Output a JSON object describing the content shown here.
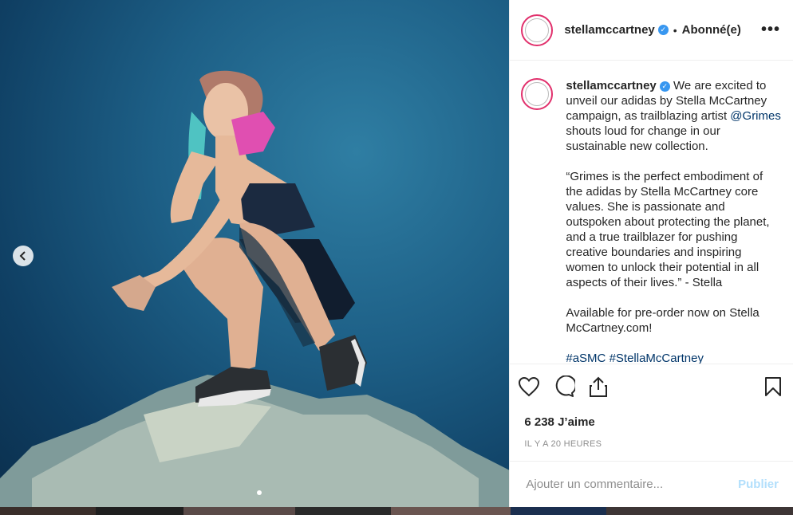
{
  "post": {
    "media": {
      "alt": "Grimes crouching on a rock",
      "carousel_prev_icon": "chevron-left-icon"
    },
    "header": {
      "username": "stellamccartney",
      "separator": "•",
      "follow_label": "Abonné(e)",
      "more_label": "•••"
    },
    "caption": {
      "username": "stellamccartney",
      "text_intro": "We are excited to unveil our adidas by Stella McCartney campaign, as trailblazing artist",
      "mention": "@Grimes",
      "text_intro_end": "shouts loud for change in our sustainable new collection.",
      "quote": "“Grimes is the perfect embodiment of the adidas by Stella McCartney core values. She is passionate and outspoken about protecting the planet, and a true trailblazer for pushing creative boundaries and inspiring women to unlock their potential in all aspects of their lives.” - Stella",
      "preorder": "Available for pre-order now on Stella McCartney.com!",
      "hashtag1": "#aSMC",
      "hashtag2": "#StellaMcCartney"
    },
    "likes": "6 238 J’aime",
    "timestamp": "IL Y A 20 HEURES",
    "comment": {
      "placeholder": "Ajouter un commentaire...",
      "publish_label": "Publier"
    }
  },
  "colors": {
    "verified": "#3897f0",
    "publish": "#b2dffc",
    "link": "#003569",
    "ring": "#e1306c"
  }
}
